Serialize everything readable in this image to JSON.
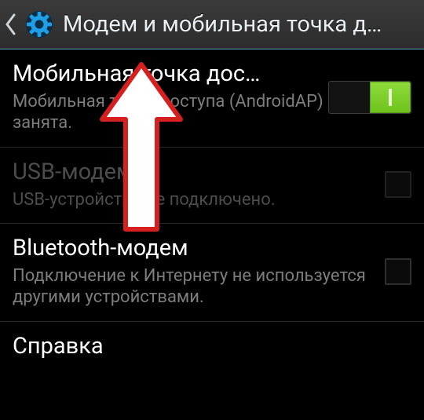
{
  "header": {
    "title": "Модем и мобильная точка д…"
  },
  "rows": {
    "hotspot": {
      "title": "Мобильная точка дос…",
      "sub": "Мобильная точка доступа (AndroidAP) занята.",
      "toggle_on": true
    },
    "usb": {
      "title": "USB-модем",
      "sub": "USB-устройство не подключено."
    },
    "bt": {
      "title": "Bluetooth-модем",
      "sub": "Подключение к Интернету не используется другими устройствами."
    },
    "help": {
      "title": "Справка"
    }
  }
}
